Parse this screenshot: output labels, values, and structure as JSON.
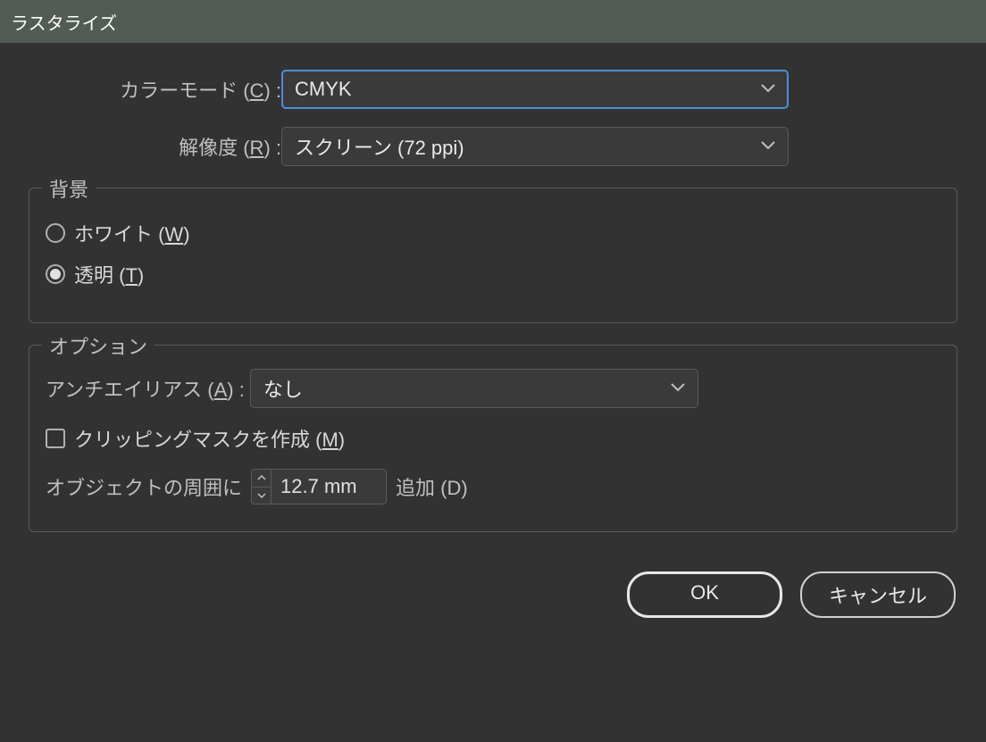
{
  "title": "ラスタライズ",
  "colorMode": {
    "label_pre": "カラーモード (",
    "label_key": "C",
    "label_post": ") :",
    "value": "CMYK"
  },
  "resolution": {
    "label_pre": "解像度 (",
    "label_key": "R",
    "label_post": ") :",
    "value": "スクリーン (72 ppi)"
  },
  "background": {
    "legend": "背景",
    "white_pre": "ホワイト (",
    "white_key": "W",
    "white_post": ")",
    "transparent_pre": "透明 (",
    "transparent_key": "T",
    "transparent_post": ")",
    "selected": "transparent"
  },
  "options": {
    "legend": "オプション",
    "antialias_label_pre": "アンチエイリアス (",
    "antialias_label_key": "A",
    "antialias_label_post": ") :",
    "antialias_value": "なし",
    "clipmask_pre": "クリッピングマスクを作成 (",
    "clipmask_key": "M",
    "clipmask_post": ")",
    "clipmask_checked": false,
    "around_pre": "オブジェクトの周囲に",
    "around_value": "12.7 mm",
    "around_post": "追加 (D)"
  },
  "buttons": {
    "ok": "OK",
    "cancel": "キャンセル"
  }
}
